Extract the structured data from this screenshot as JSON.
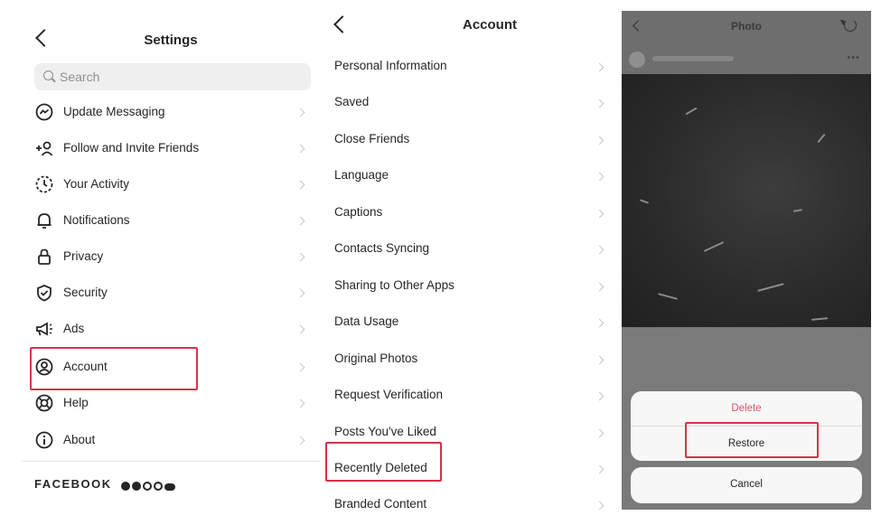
{
  "settings": {
    "title": "Settings",
    "search_placeholder": "Search",
    "items": [
      {
        "label": "Update Messaging",
        "icon": "messenger-icon"
      },
      {
        "label": "Follow and Invite Friends",
        "icon": "add-person-icon"
      },
      {
        "label": "Your Activity",
        "icon": "activity-icon"
      },
      {
        "label": "Notifications",
        "icon": "bell-icon"
      },
      {
        "label": "Privacy",
        "icon": "lock-icon"
      },
      {
        "label": "Security",
        "icon": "shield-icon"
      },
      {
        "label": "Ads",
        "icon": "megaphone-icon"
      },
      {
        "label": "Account",
        "icon": "account-icon"
      },
      {
        "label": "Help",
        "icon": "lifebuoy-icon"
      },
      {
        "label": "About",
        "icon": "info-icon"
      }
    ],
    "footer_brand": "FACEBOOK"
  },
  "account": {
    "title": "Account",
    "items": [
      "Personal Information",
      "Saved",
      "Close Friends",
      "Language",
      "Captions",
      "Contacts Syncing",
      "Sharing to Other Apps",
      "Data Usage",
      "Original Photos",
      "Request Verification",
      "Posts You've Liked",
      "Recently Deleted",
      "Branded Content"
    ]
  },
  "photo": {
    "title": "Photo",
    "sheet": {
      "delete_label": "Delete",
      "restore_label": "Restore",
      "cancel_label": "Cancel"
    }
  },
  "colors": {
    "highlight": "#d6334a",
    "delete": "#e0506a"
  }
}
